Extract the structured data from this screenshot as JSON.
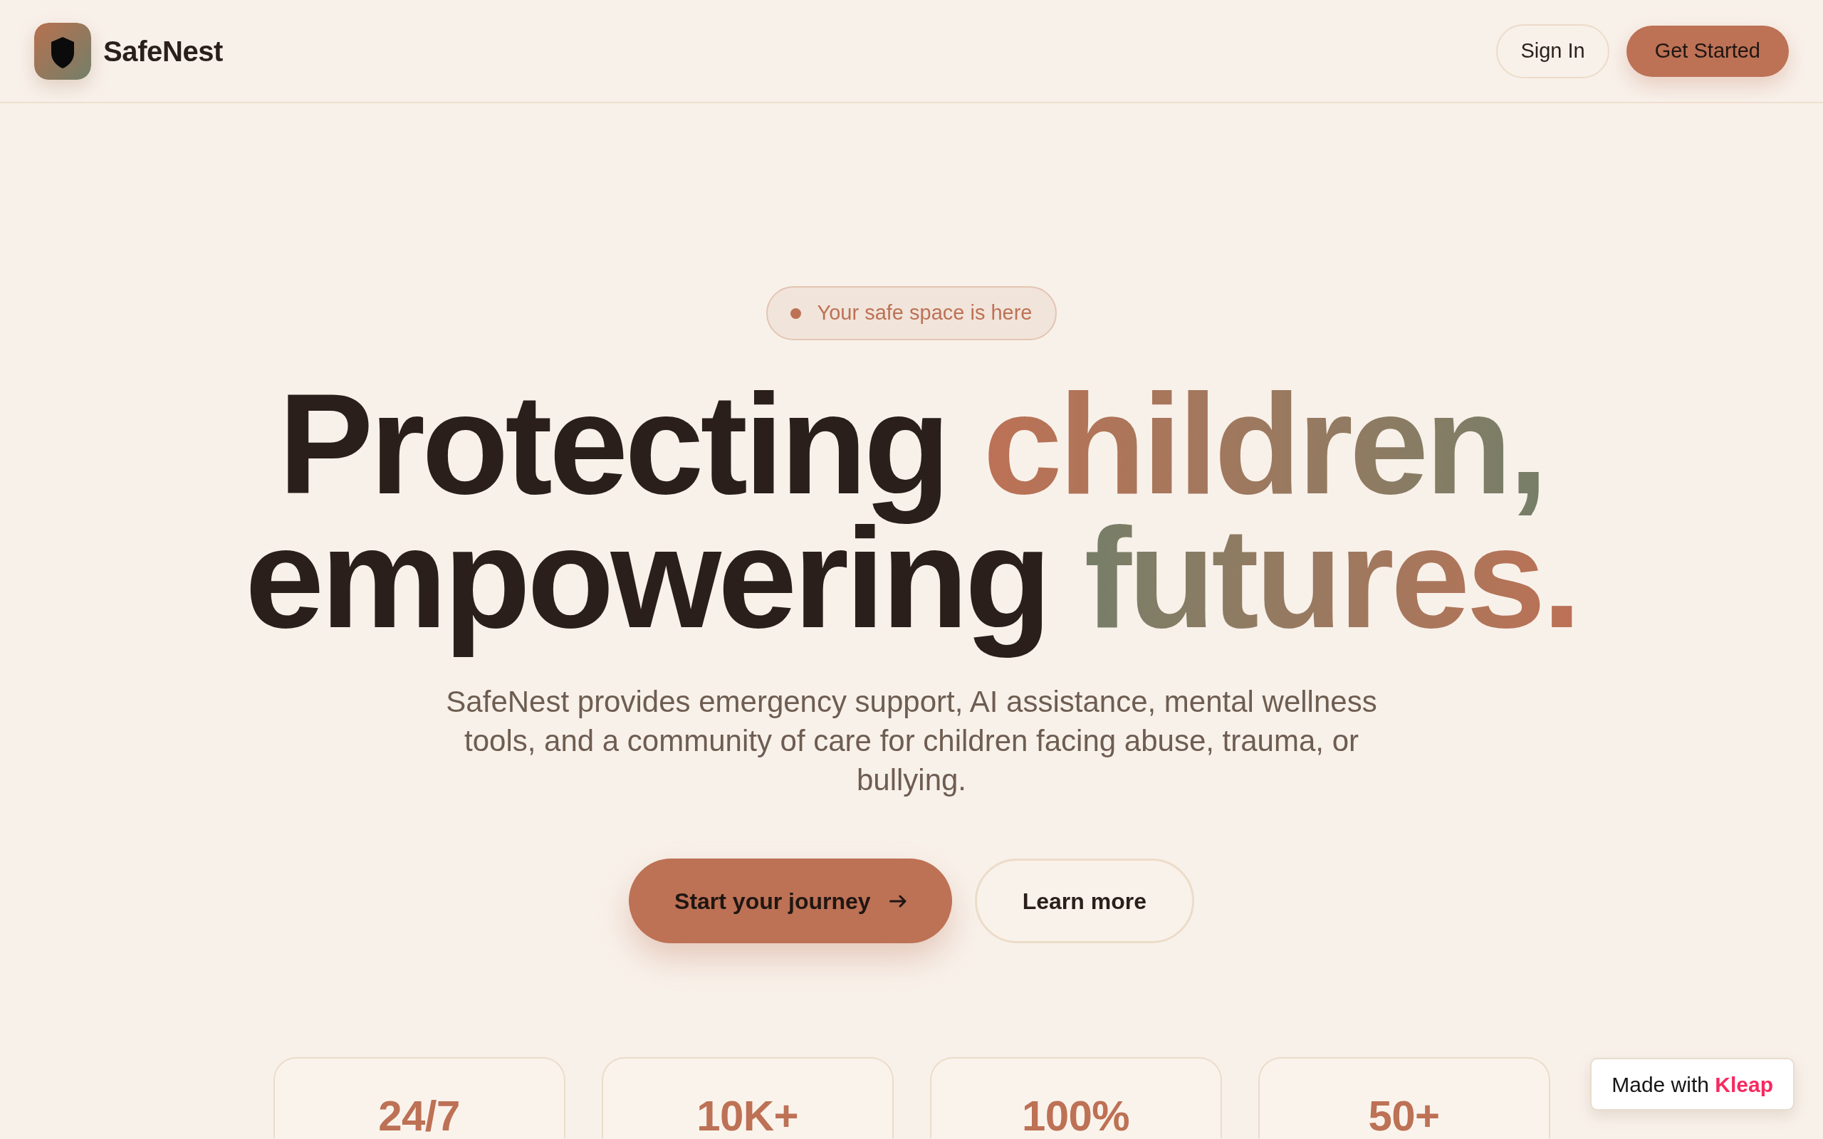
{
  "header": {
    "brand": "SafeNest",
    "buttons": [
      {
        "label": "Sign In",
        "kind": "outline"
      },
      {
        "label": "Get Started",
        "kind": "primary"
      }
    ]
  },
  "hero": {
    "badge": "Your safe space is here",
    "heading": [
      {
        "text": "Protecting",
        "highlight": "children,"
      },
      {
        "text": "empowering",
        "highlight": "futures."
      }
    ],
    "description": "SafeNest provides emergency support, AI assistance, mental wellness tools, and a community of care for children facing abuse, trauma, or bullying.",
    "actions": [
      {
        "label": "Start your journey",
        "kind": "primary"
      },
      {
        "label": "Learn more",
        "kind": "outline"
      }
    ]
  },
  "stats": [
    {
      "value": "24/7"
    },
    {
      "value": "10K+"
    },
    {
      "value": "100%"
    },
    {
      "value": "50+"
    }
  ],
  "made_with": {
    "prefix": "Made with",
    "brand": "Kleap"
  }
}
